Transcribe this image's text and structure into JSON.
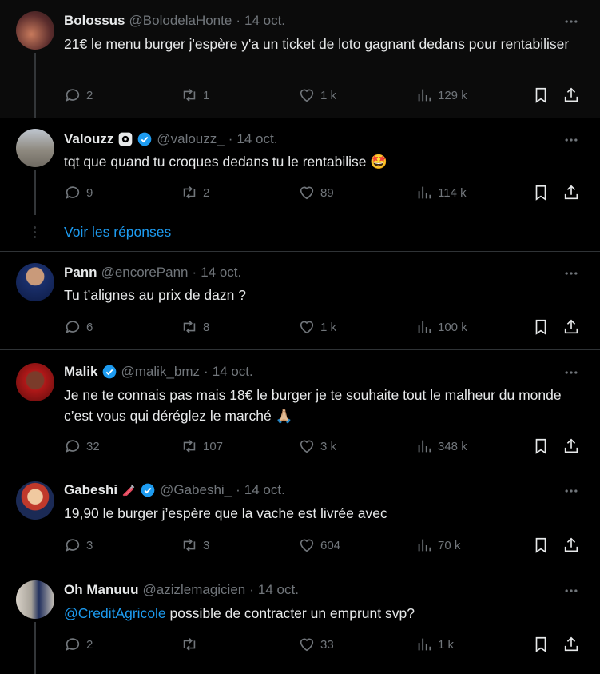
{
  "tweets": [
    {
      "name": "Bolossus",
      "handle": "@BolodelaHonte",
      "date": "14 oct.",
      "text": "21€ le menu burger j'espère y'a un ticket de loto gagnant dedans pour rentabiliser",
      "replies": "2",
      "reposts": "1",
      "likes": "1 k",
      "views": "129 k"
    },
    {
      "name": "Valouzz",
      "handle": "@valouzz_",
      "date": "14 oct.",
      "text": "tqt que quand tu croques dedans tu le rentabilise",
      "replies": "9",
      "reposts": "2",
      "likes": "89",
      "views": "114 k",
      "emoji": "🤩"
    },
    {
      "name": "Pann",
      "handle": "@encorePann",
      "date": "14 oct.",
      "text": "Tu t’alignes au prix de dazn ?",
      "replies": "6",
      "reposts": "8",
      "likes": "1 k",
      "views": "100 k"
    },
    {
      "name": "Malik",
      "handle": "@malik_bmz",
      "date": "14 oct.",
      "text": "Je ne te connais pas mais 18€ le burger je te souhaite tout le malheur du monde c’est vous qui déréglez le marché",
      "replies": "32",
      "reposts": "107",
      "likes": "3 k",
      "views": "348 k",
      "emoji": "🙏🏼"
    },
    {
      "name": "Gabeshi",
      "handle": "@Gabeshi_",
      "date": "14 oct.",
      "text": "19,90 le burger j’espère que la vache est livrée avec",
      "replies": "3",
      "reposts": "3",
      "likes": "604",
      "views": "70 k"
    },
    {
      "name": "Oh Manuuu",
      "handle": "@azizlemagicien",
      "date": "14 oct.",
      "mention": "@CreditAgricole",
      "text": " possible de contracter un emprunt svp?",
      "replies": "2",
      "reposts": "",
      "likes": "33",
      "views": "1 k"
    }
  ],
  "show_replies": "Voir les réponses",
  "colors": {
    "accent": "#1d9bf0",
    "muted": "#71767b",
    "text": "#e7e9ea",
    "bg": "#000000"
  }
}
